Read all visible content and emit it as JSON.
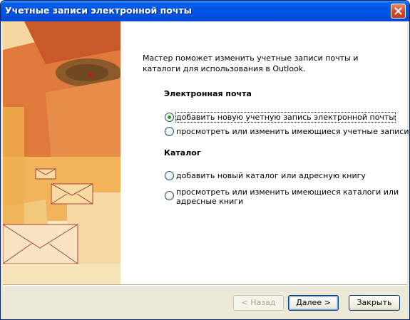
{
  "window": {
    "title": "Учетные записи электронной почты"
  },
  "intro": "Мастер поможет изменить учетные записи почты и каталоги для использования в Outlook.",
  "email_section": {
    "heading": "Электронная почта",
    "options": [
      {
        "label": "добавить новую учетную запись электронной почты",
        "checked": true
      },
      {
        "label": "просмотреть или изменить имеющиеся учетные записи",
        "checked": false
      }
    ]
  },
  "directory_section": {
    "heading": "Каталог",
    "options": [
      {
        "label": "добавить новый каталог или адресную книгу",
        "checked": false
      },
      {
        "label_line1": "просмотреть или изменить имеющиеся каталоги или",
        "label_line2": "адресные книги",
        "checked": false
      }
    ]
  },
  "buttons": {
    "back": "< Назад",
    "next": "Далее >",
    "close": "Закрыть"
  },
  "colors": {
    "titlebar": "#0055e5",
    "dialog_bg": "#ece9d8",
    "radio_dot": "#21a121"
  }
}
